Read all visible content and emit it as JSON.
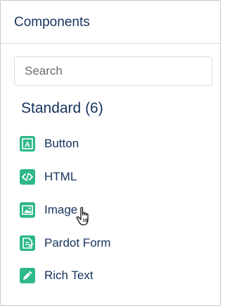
{
  "panel": {
    "title": "Components"
  },
  "search": {
    "placeholder": "Search",
    "value": ""
  },
  "section": {
    "title": "Standard (6)"
  },
  "items": [
    {
      "label": "Button",
      "icon": "button-icon"
    },
    {
      "label": "HTML",
      "icon": "html-code-icon"
    },
    {
      "label": "Image",
      "icon": "image-icon"
    },
    {
      "label": "Pardot Form",
      "icon": "form-icon"
    },
    {
      "label": "Rich Text",
      "icon": "pencil-icon"
    }
  ],
  "colors": {
    "accent": "#2eb88b",
    "text": "#16325c",
    "border": "#c9c9c9"
  },
  "cursor": {
    "type": "hand-pointer",
    "icon": "hand-pointer-cursor-icon"
  }
}
